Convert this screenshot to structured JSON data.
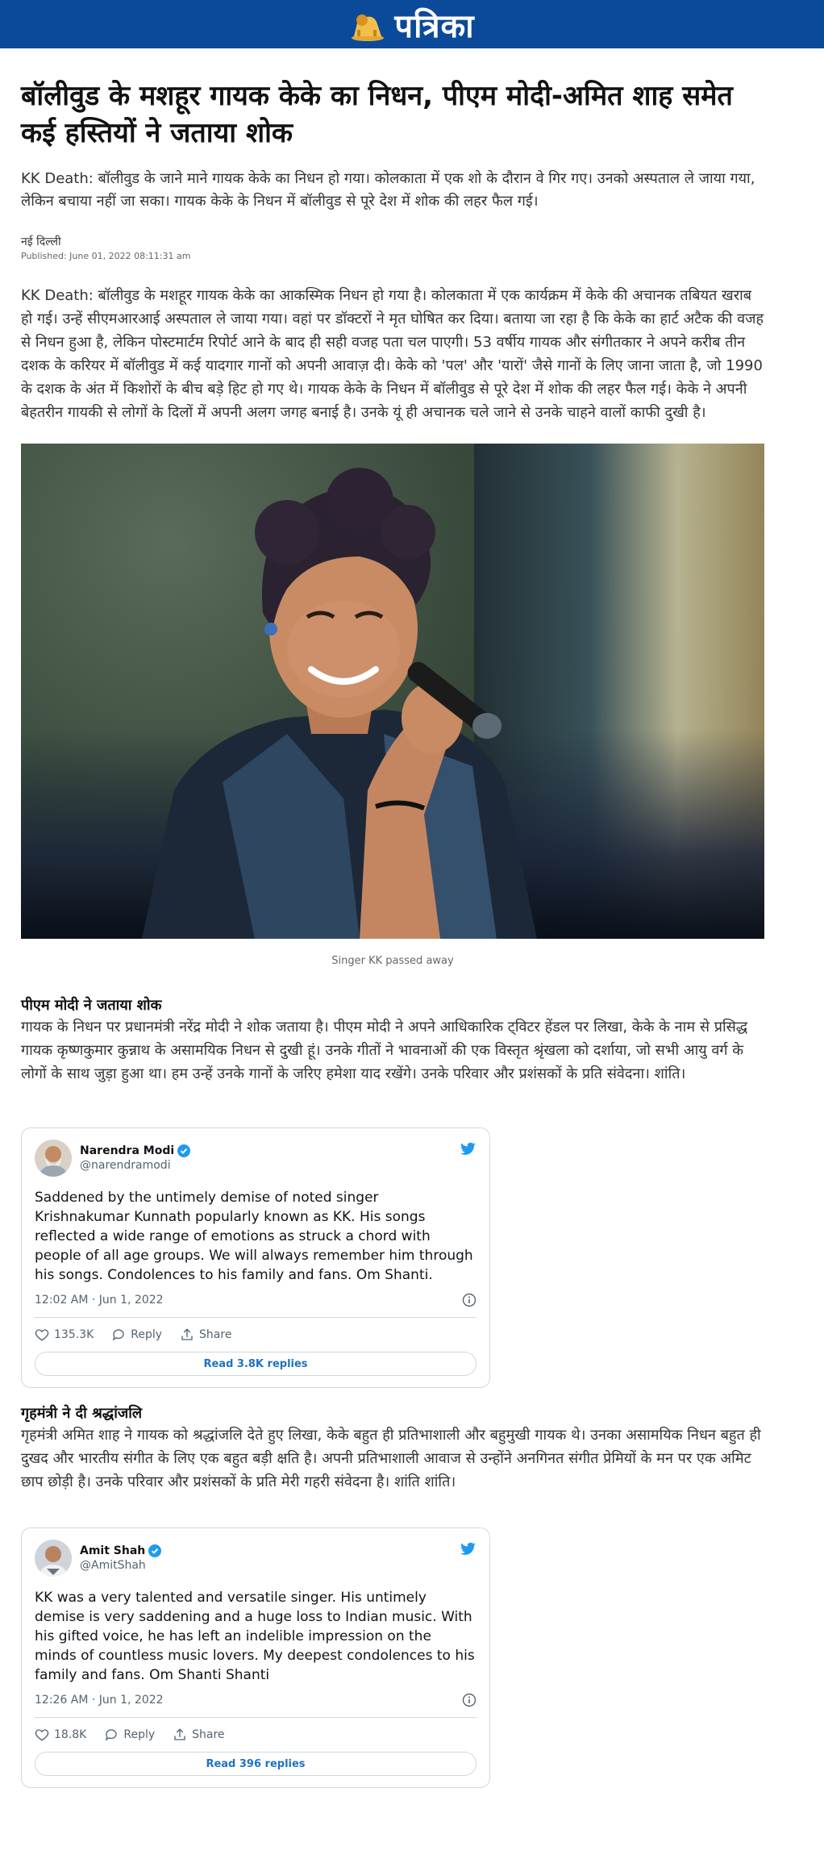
{
  "brand": {
    "name": "पत्रिका",
    "logo_icon": "lion-emblem-icon",
    "header_color": "#0b4a9b"
  },
  "article": {
    "title": "बॉलीवुड के मशहूर गायक केके का निधन, पीएम मोदी-अमित शाह समेत कई हस्तियों ने जताया शोक",
    "summary": "KK Death: बॉलीवुड के जाने माने गायक केके का निधन हो गया। कोलकाता में एक शो के दौरान वे गिर गए। उनको अस्पताल ले जाया गया, लेकिन बचाया नहीं जा सका। गायक केके के निधन में बॉलीवुड से पूरे देश में शोक की लहर फैल गई।",
    "location": "नई दिल्ली",
    "published": "Published: June 01, 2022 08:11:31 am",
    "body": "KK Death: बॉलीवुड के मशहूर गायक केके का आकस्मिक निधन हो गया है। कोलकाता में एक कार्यक्रम में केके की अचानक तबियत खराब हो गई। उन्हें सीएमआरआई अस्पताल ले जाया गया। वहां पर डॉक्टरों ने मृत घोषित कर दिया। बताया जा रहा है कि केके का हार्ट अटैक की वजह से निधन हुआ है, लेकिन पोस्टमार्टम रिपोर्ट आने के बाद ही सही वजह पता चल पाएगी। 53 वर्षीय गायक और संगीतकार ने अपने करीब तीन दशक के करियर में बॉलीवुड में कई यादगार गानों को अपनी आवाज़ दी। केके को 'पल' और 'यारों' जैसे गानों के लिए जाना जाता है, जो 1990 के दशक के अंत में किशोरों के बीच बड़े हिट हो गए थे। गायक केके के निधन में बॉलीवुड से पूरे देश में शोक की लहर फैल गई। केके ने अपनी बेहतरीन गायकी से लोगों के दिलों में अपनी अलग जगह बनाई है। उनके यूं ही अचानक चले जाने से उनके चाहने वालों काफी दुखी है।",
    "image_caption": "Singer KK passed away",
    "section1": {
      "heading": "पीएम मोदी ने जताया शोक",
      "text": "गायक के निधन पर प्रधानमंत्री नरेंद्र मोदी ने शोक जताया है। पीएम मोदी ने अपने आधिकारिक ट्विटर हेंडल पर लिखा, केके के नाम से प्रसिद्ध गायक कृष्णकुमार कुन्नाथ के असामयिक निधन से दुखी हूं। उनके गीतों ने भावनाओं की एक विस्तृत श्रृंखला को दर्शाया, जो सभी आयु वर्ग के लोगों के साथ जुड़ा हुआ था। हम उन्हें उनके गानों के जरिए हमेशा याद रखेंगे। उनके परिवार और प्रशंसकों के प्रति संवेदना। शांति।"
    },
    "section2": {
      "heading": "गृहमंत्री ने दी श्रद्धांजलि",
      "text": "गृहमंत्री अमित शाह ने गायक को श्रद्धांजलि देते हुए लिखा, केके बहुत ही प्रतिभाशाली और बहुमुखी गायक थे। उनका असामयिक निधन बहुत ही दुखद और भारतीय संगीत के लिए एक बहुत बड़ी क्षति है। अपनी प्रतिभाशाली आवाज से उन्होंने अनगिनत संगीत प्रेमियों के मन पर एक अमिट छाप छोड़ी है। उनके परिवार और प्रशंसकों के प्रति मेरी गहरी संवेदना है। शांति शांति।"
    }
  },
  "tweets": [
    {
      "name": "Narendra Modi",
      "handle": "@narendramodi",
      "text": "Saddened by the untimely demise of noted singer Krishnakumar Kunnath popularly known as KK. His songs reflected a wide range of emotions as struck a chord with people of all age groups. We will always remember him through his songs. Condolences to his family and fans. Om Shanti.",
      "time": "12:02 AM · Jun 1, 2022",
      "likes": "135.3K",
      "reply_label": "Reply",
      "share_label": "Share",
      "read_replies": "Read 3.8K replies"
    },
    {
      "name": "Amit Shah",
      "handle": "@AmitShah",
      "text": "KK was a very talented and versatile singer. His untimely demise is very saddening and a huge loss to Indian music. With his gifted voice, he has left an indelible impression on the minds of countless music lovers. My deepest condolences to his family and fans. Om Shanti Shanti",
      "time": "12:26 AM · Jun 1, 2022",
      "likes": "18.8K",
      "reply_label": "Reply",
      "share_label": "Share",
      "read_replies": "Read 396 replies"
    }
  ],
  "colors": {
    "twitter_blue": "#1d9bf0",
    "link_blue": "#1d73c4"
  }
}
